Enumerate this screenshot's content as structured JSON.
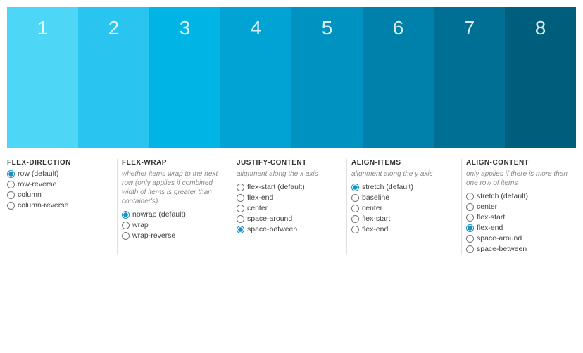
{
  "colorBar": {
    "columns": [
      {
        "num": "1",
        "colorClass": "col-1"
      },
      {
        "num": "2",
        "colorClass": "col-2"
      },
      {
        "num": "3",
        "colorClass": "col-3"
      },
      {
        "num": "4",
        "colorClass": "col-4"
      },
      {
        "num": "5",
        "colorClass": "col-5"
      },
      {
        "num": "6",
        "colorClass": "col-6"
      },
      {
        "num": "7",
        "colorClass": "col-7"
      },
      {
        "num": "8",
        "colorClass": "col-8"
      }
    ]
  },
  "controls": {
    "flexDirection": {
      "title": "FLEX-DIRECTION",
      "desc": "",
      "options": [
        {
          "label": "row (default)",
          "value": "row",
          "checked": true
        },
        {
          "label": "row-reverse",
          "value": "row-reverse",
          "checked": false
        },
        {
          "label": "column",
          "value": "column",
          "checked": false
        },
        {
          "label": "column-reverse",
          "value": "column-reverse",
          "checked": false
        }
      ]
    },
    "flexWrap": {
      "title": "FLEX-WRAP",
      "desc": "whether items wrap to the next row (only applies if combined width of items is greater than container's)",
      "options": [
        {
          "label": "nowrap (default)",
          "value": "nowrap",
          "checked": true
        },
        {
          "label": "wrap",
          "value": "wrap",
          "checked": false
        },
        {
          "label": "wrap-reverse",
          "value": "wrap-reverse",
          "checked": false
        }
      ]
    },
    "justifyContent": {
      "title": "JUSTIFY-CONTENT",
      "desc": "alignment along the x axis",
      "options": [
        {
          "label": "flex-start (default)",
          "value": "flex-start",
          "checked": false
        },
        {
          "label": "flex-end",
          "value": "flex-end",
          "checked": false
        },
        {
          "label": "center",
          "value": "center",
          "checked": false
        },
        {
          "label": "space-around",
          "value": "space-around",
          "checked": false
        },
        {
          "label": "space-between",
          "value": "space-between",
          "checked": true
        }
      ]
    },
    "alignItems": {
      "title": "ALIGN-ITEMS",
      "desc": "alignment along the y axis",
      "options": [
        {
          "label": "stretch (default)",
          "value": "stretch",
          "checked": true
        },
        {
          "label": "baseline",
          "value": "baseline",
          "checked": false
        },
        {
          "label": "center",
          "value": "center",
          "checked": false
        },
        {
          "label": "flex-start",
          "value": "flex-start",
          "checked": false
        },
        {
          "label": "flex-end",
          "value": "flex-end",
          "checked": false
        }
      ]
    },
    "alignContent": {
      "title": "ALIGN-CONTENT",
      "desc": "only applies if there is more than one row of items",
      "options": [
        {
          "label": "stretch (default)",
          "value": "stretch",
          "checked": false
        },
        {
          "label": "center",
          "value": "center",
          "checked": false
        },
        {
          "label": "flex-start",
          "value": "flex-start",
          "checked": false
        },
        {
          "label": "flex-end",
          "value": "flex-end",
          "checked": true
        },
        {
          "label": "space-around",
          "value": "space-around",
          "checked": false
        },
        {
          "label": "space-between",
          "value": "space-between",
          "checked": false
        }
      ]
    }
  }
}
